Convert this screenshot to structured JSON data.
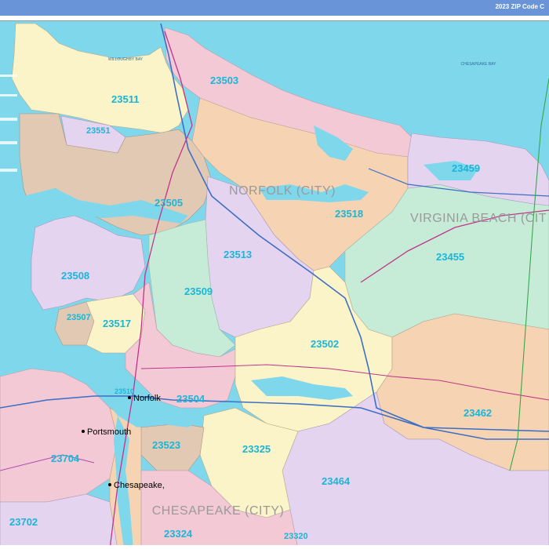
{
  "header": {
    "title": "2023 ZIP Code C"
  },
  "zip_codes": [
    "23511",
    "23503",
    "23551",
    "23505",
    "23518",
    "23459",
    "23455",
    "23513",
    "23508",
    "23509",
    "23507",
    "23517",
    "23502",
    "23504",
    "23462",
    "23523",
    "23325",
    "23464",
    "23704",
    "23324",
    "23320",
    "23702",
    "23510"
  ],
  "cities": [
    "Norfolk",
    "Portsmouth",
    "Chesapeake,"
  ],
  "city_names": [
    "NORFOLK (CITY)",
    "VIRGINIA BEACH (CIT",
    "CHESAPEAKE (CITY)"
  ],
  "water_labels": [
    "WILLOUGHBY BAY",
    "CHESAPEAKE BAY"
  ],
  "colors": {
    "water": "#7fd7ec",
    "header": "#6a94d8",
    "zip_label": "#1ab6d8"
  }
}
